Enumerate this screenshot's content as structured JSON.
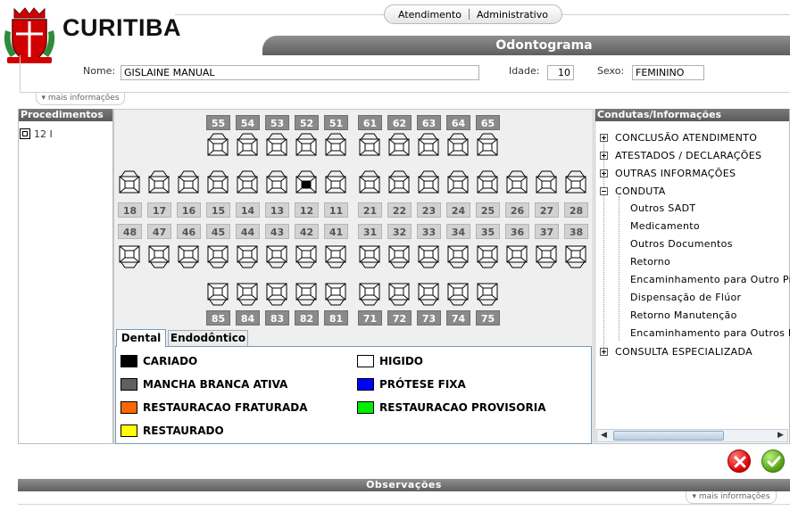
{
  "brand": {
    "name": "CURITIBA",
    "crest": "city-coat-of-arms"
  },
  "topnav": {
    "atendimento": "Atendimento",
    "administrativo": "Administrativo"
  },
  "page_title": "Odontograma",
  "patient": {
    "nome_label": "Nome:",
    "nome_value": "GISLAINE MANUAL",
    "idade_label": "Idade:",
    "idade_value": "10",
    "sexo_label": "Sexo:",
    "sexo_value": "FEMININO"
  },
  "more_info_label": "▾ mais informações",
  "procedimentos": {
    "title": "Procedimentos",
    "items": [
      "12 I"
    ]
  },
  "odontograma": {
    "upper_deciduous": [
      "55",
      "54",
      "53",
      "52",
      "51",
      "61",
      "62",
      "63",
      "64",
      "65"
    ],
    "upper_permanent": [
      "18",
      "17",
      "16",
      "15",
      "14",
      "13",
      "12",
      "11",
      "21",
      "22",
      "23",
      "24",
      "25",
      "26",
      "27",
      "28"
    ],
    "lower_permanent": [
      "48",
      "47",
      "46",
      "45",
      "44",
      "43",
      "42",
      "41",
      "31",
      "32",
      "33",
      "34",
      "35",
      "36",
      "37",
      "38"
    ],
    "lower_deciduous": [
      "85",
      "84",
      "83",
      "82",
      "81",
      "71",
      "72",
      "73",
      "74",
      "75"
    ],
    "marked_tooth": "12",
    "marked_color": "#000000"
  },
  "tabs": {
    "dental": "Dental",
    "endodontico": "Endodôntico"
  },
  "legend": [
    {
      "label": "CARIADO",
      "color": "#000000"
    },
    {
      "label": "HIGIDO",
      "color": "#ffffff"
    },
    {
      "label": "MANCHA BRANCA ATIVA",
      "color": "#606060"
    },
    {
      "label": "PRÓTESE FIXA",
      "color": "#0000ff"
    },
    {
      "label": "RESTAURACAO FRATURADA",
      "color": "#ff6600"
    },
    {
      "label": "RESTAURACAO PROVISORIA",
      "color": "#00ee00"
    },
    {
      "label": "RESTAURADO",
      "color": "#ffff00"
    }
  ],
  "condutas": {
    "title": "Condutas/Informações",
    "nodes": [
      {
        "label": "CONCLUSÃO ATENDIMENTO",
        "expanded": false
      },
      {
        "label": "ATESTADOS / DECLARAÇÕES",
        "expanded": false
      },
      {
        "label": "OUTRAS INFORMAÇÕES",
        "expanded": false
      },
      {
        "label": "CONDUTA",
        "expanded": true
      },
      {
        "label": "CONSULTA ESPECIALIZADA",
        "expanded": false
      }
    ],
    "conduta_children": [
      "Outros SADT",
      "Medicamento",
      "Outros Documentos",
      "Retorno",
      "Encaminhamento para Outro Pr",
      "Dispensação de Flúor",
      "Retorno Manutenção",
      "Encaminhamento para Outros P"
    ]
  },
  "observacoes_title": "Observações"
}
